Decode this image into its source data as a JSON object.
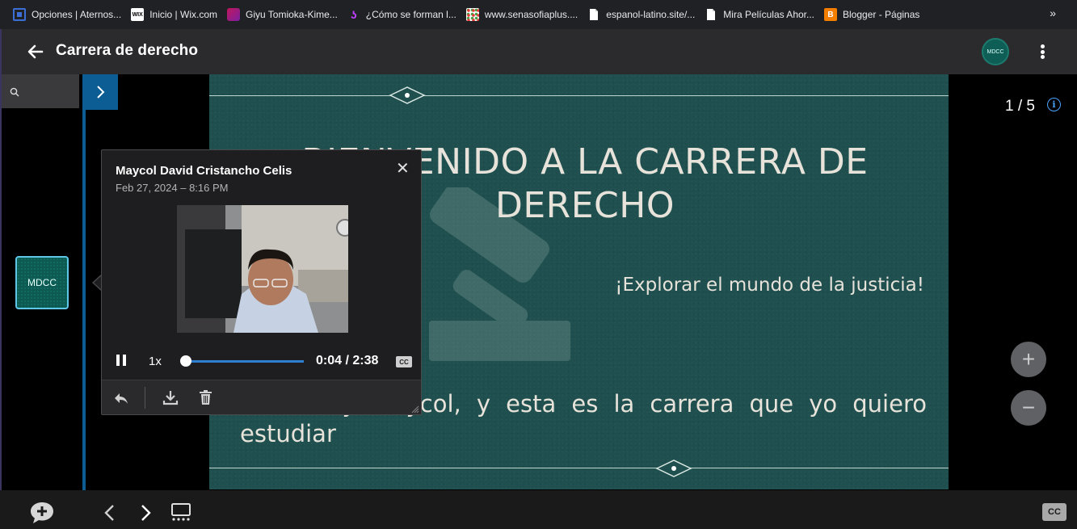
{
  "bookmarks": [
    {
      "label": "Opciones | Aternos...",
      "icon": "aternos-icon",
      "color": "#3b6fd6"
    },
    {
      "label": "Inicio | Wix.com",
      "icon": "wix-icon",
      "color": "#ffffff"
    },
    {
      "label": "Giyu Tomioka-Kime...",
      "icon": "anime-icon",
      "color": "#c2185b"
    },
    {
      "label": "¿Cómo se forman l...",
      "icon": "swirl-icon",
      "color": "#a020f0"
    },
    {
      "label": "www.senasofiaplus....",
      "icon": "sena-icon",
      "color": "#ffffff"
    },
    {
      "label": "espanol-latino.site/...",
      "icon": "page-icon",
      "color": "#ffffff"
    },
    {
      "label": "Mira Películas Ahor...",
      "icon": "page-icon",
      "color": "#ffffff"
    },
    {
      "label": "Blogger - Páginas",
      "icon": "blogger-icon",
      "color": "#f57d00"
    }
  ],
  "bookmarks_more": "»",
  "header": {
    "title": "Carrera de derecho",
    "avatar_initials": "MDCC"
  },
  "sidebar": {
    "thumbnail_label": "MDCC"
  },
  "slide": {
    "title": "BIENVENIDO A LA CARRERA DE DERECHO",
    "subtitle": "¡Explorar el mundo de la justicia!",
    "body": "Hola, soy Maycol, y esta es la carrera que yo quiero estudiar"
  },
  "pager": {
    "current": "1",
    "total": "5",
    "text": "1 / 5"
  },
  "zoom": {
    "in_label": "+",
    "out_label": "−"
  },
  "popup": {
    "author": "Maycol David Cristancho Celis",
    "date": "Feb 27, 2024 – 8:16 PM",
    "close": "✕",
    "speed": "1x",
    "time": "0:04 / 2:38",
    "progress": 0.025,
    "cc": "CC"
  },
  "bottom": {
    "cc": "CC"
  },
  "colors": {
    "accent": "#0b5d94",
    "slide_bg": "#1f4f4e",
    "slide_text": "#e7e3da"
  }
}
